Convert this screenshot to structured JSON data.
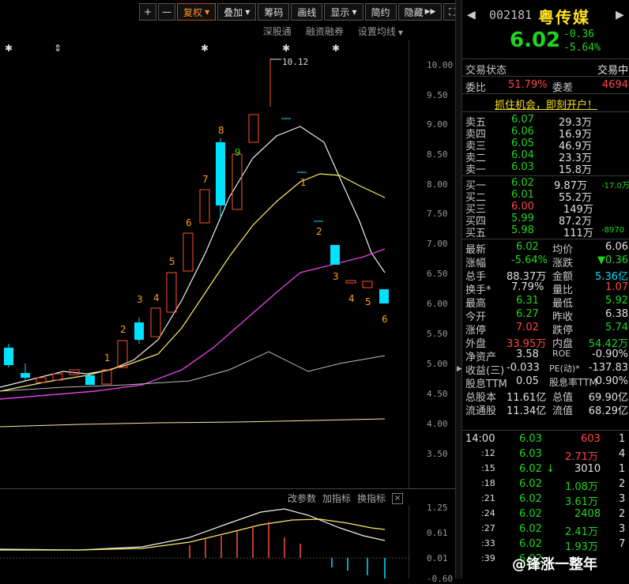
{
  "toolbar": {
    "plus": "+",
    "minus": "—",
    "fuquan": "复权",
    "diejia": "叠加",
    "chouma": "筹码",
    "huaxian": "画线",
    "xianshi": "显示",
    "jianyue": "简约",
    "yincang": "隐藏"
  },
  "subtools": [
    "深股通",
    "融资融券",
    "设置均线"
  ],
  "chart": {
    "y_ticks": [
      "10.00",
      "9.50",
      "9.00",
      "8.50",
      "8.00",
      "7.50",
      "7.00",
      "6.50",
      "6.00",
      "5.50",
      "5.00",
      "4.50",
      "4.00",
      "3.50"
    ],
    "max_label": "10.12",
    "wave_labels_up": [
      "1",
      "2",
      "3",
      "4",
      "5",
      "6",
      "7",
      "8",
      "9"
    ],
    "wave_labels_down": [
      "1",
      "2",
      "3",
      "4",
      "5",
      "6"
    ],
    "star_markers": [
      "✱",
      "⇕",
      "✱",
      "✱",
      "✱"
    ]
  },
  "indicator": {
    "tools": [
      "改参数",
      "加指标",
      "换指标"
    ],
    "close": "×",
    "y_ticks": [
      "1.25",
      "0.61",
      "0.01",
      "-0.60"
    ]
  },
  "quote": {
    "code": "002181",
    "name": "粤传媒",
    "price": "6.02",
    "change": "-0.36",
    "change_pct": "-5.64%",
    "status_label": "交易状态",
    "status_value": "交易中",
    "weibi_label": "委比",
    "weibi_value": "51.79%",
    "weicha_label": "委差",
    "weicha_value": "4694",
    "promo": "抓住机会，即刻开户！",
    "asks": [
      {
        "label": "卖五",
        "price": "6.07",
        "vol": "29.3万"
      },
      {
        "label": "卖四",
        "price": "6.06",
        "vol": "16.9万"
      },
      {
        "label": "卖三",
        "price": "6.05",
        "vol": "46.9万"
      },
      {
        "label": "卖二",
        "price": "6.04",
        "vol": "23.3万"
      },
      {
        "label": "卖一",
        "price": "6.03",
        "vol": "15.8万"
      }
    ],
    "bids": [
      {
        "label": "买一",
        "price": "6.02",
        "vol": "9.87万",
        "delta": "-17.0万"
      },
      {
        "label": "买二",
        "price": "6.01",
        "vol": "55.2万",
        "delta": ""
      },
      {
        "label": "买三",
        "price": "6.00",
        "vol": "149万",
        "delta": ""
      },
      {
        "label": "买四",
        "price": "5.99",
        "vol": "87.2万",
        "delta": ""
      },
      {
        "label": "买五",
        "price": "5.98",
        "vol": "111万",
        "delta": "-8970"
      }
    ],
    "stats": [
      {
        "l1": "最新",
        "v1": "6.02",
        "c1": "grn",
        "l2": "均价",
        "v2": "6.06",
        "c2": "wht"
      },
      {
        "l1": "涨幅",
        "v1": "-5.64%",
        "c1": "grn",
        "l2": "涨跌",
        "v2": "▼0.36",
        "c2": "grn"
      },
      {
        "l1": "总手",
        "v1": "88.37万",
        "c1": "wht",
        "l2": "金额",
        "v2": "5.36亿",
        "c2": "cyan"
      },
      {
        "l1": "换手*",
        "v1": "7.79%",
        "c1": "wht",
        "l2": "量比",
        "v2": "1.07",
        "c2": "red"
      },
      {
        "l1": "最高",
        "v1": "6.31",
        "c1": "grn",
        "l2": "最低",
        "v2": "5.92",
        "c2": "grn"
      },
      {
        "l1": "今开",
        "v1": "6.27",
        "c1": "grn",
        "l2": "昨收",
        "v2": "6.38",
        "c2": "wht"
      },
      {
        "l1": "涨停",
        "v1": "7.02",
        "c1": "red",
        "l2": "跌停",
        "v2": "5.74",
        "c2": "grn"
      },
      {
        "l1": "外盘",
        "v1": "33.95万",
        "c1": "red",
        "l2": "内盘",
        "v2": "54.42万",
        "c2": "grn"
      },
      {
        "l1": "净资产",
        "v1": "3.58",
        "c1": "wht",
        "l2": "ROE",
        "v2": "-0.90%",
        "c2": "wht"
      },
      {
        "l1": "收益(三)",
        "v1": "-0.033",
        "c1": "wht",
        "l2": "PE(动)*",
        "v2": "-137.83",
        "c2": "wht"
      },
      {
        "l1": "股息TTM",
        "v1": "0.05",
        "c1": "wht",
        "l2": "股息率TTM",
        "v2": "0.90%",
        "c2": "wht"
      },
      {
        "l1": "总股本",
        "v1": "11.61亿",
        "c1": "wht",
        "l2": "总值",
        "v2": "69.90亿",
        "c2": "wht"
      },
      {
        "l1": "流通股",
        "v1": "11.34亿",
        "c1": "wht",
        "l2": "流值",
        "v2": "68.29亿",
        "c2": "wht"
      }
    ],
    "ticks": [
      {
        "time": "14:00",
        "price": "6.03",
        "vol": "603",
        "vc": "red",
        "n": "1",
        "arrow": ""
      },
      {
        "time": ":12",
        "price": "6.03",
        "vol": "2.71万",
        "vc": "red",
        "n": "4",
        "arrow": ""
      },
      {
        "time": ":15",
        "price": "6.02",
        "vol": "3010",
        "vc": "wht",
        "n": "1",
        "arrow": "↓"
      },
      {
        "time": ":18",
        "price": "6.02",
        "vol": "1.08万",
        "vc": "grn",
        "n": "2",
        "arrow": ""
      },
      {
        "time": ":21",
        "price": "6.02",
        "vol": "3.61万",
        "vc": "grn",
        "n": "3",
        "arrow": ""
      },
      {
        "time": ":24",
        "price": "6.02",
        "vol": "2408",
        "vc": "grn",
        "n": "2",
        "arrow": ""
      },
      {
        "time": ":27",
        "price": "6.02",
        "vol": "2.41万",
        "vc": "grn",
        "n": "3",
        "arrow": ""
      },
      {
        "time": ":33",
        "price": "6.02",
        "vol": "1.93万",
        "vc": "grn",
        "n": "7",
        "arrow": ""
      },
      {
        "time": ":39",
        "price": "6.02",
        "vol": "",
        "vc": "grn",
        "n": "",
        "arrow": ""
      }
    ],
    "watermark": "@锋涨一整年"
  }
}
